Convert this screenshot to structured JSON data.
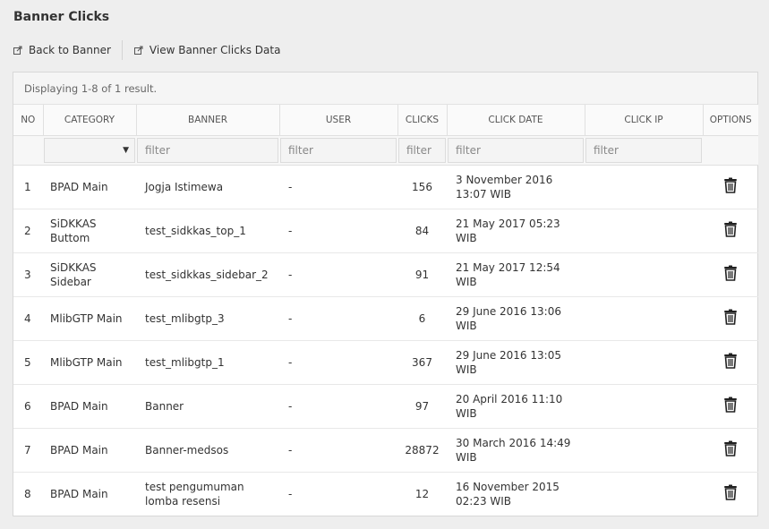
{
  "page": {
    "title": "Banner Clicks"
  },
  "toolbar": {
    "back_label": "Back to Banner",
    "view_data_label": "View Banner Clicks Data"
  },
  "grid": {
    "summary": "Displaying 1-8 of 1 result.",
    "columns": [
      "NO",
      "CATEGORY",
      "BANNER",
      "USER",
      "CLICKS",
      "CLICK DATE",
      "CLICK IP",
      "OPTIONS"
    ],
    "filter_placeholder": "filter",
    "rows": [
      {
        "no": "1",
        "category": "BPAD Main",
        "banner": "Jogja Istimewa",
        "user": "-",
        "clicks": "156",
        "date": "3 November 2016 13:07 WIB",
        "ip": ""
      },
      {
        "no": "2",
        "category": "SiDKKAS Buttom",
        "banner": "test_sidkkas_top_1",
        "user": "-",
        "clicks": "84",
        "date": "21 May 2017 05:23 WIB",
        "ip": ""
      },
      {
        "no": "3",
        "category": "SiDKKAS Sidebar",
        "banner": "test_sidkkas_sidebar_2",
        "user": "-",
        "clicks": "91",
        "date": "21 May 2017 12:54 WIB",
        "ip": ""
      },
      {
        "no": "4",
        "category": "MlibGTP Main",
        "banner": "test_mlibgtp_3",
        "user": "-",
        "clicks": "6",
        "date": "29 June 2016 13:06 WIB",
        "ip": ""
      },
      {
        "no": "5",
        "category": "MlibGTP Main",
        "banner": "test_mlibgtp_1",
        "user": "-",
        "clicks": "367",
        "date": "29 June 2016 13:05 WIB",
        "ip": ""
      },
      {
        "no": "6",
        "category": "BPAD Main",
        "banner": "Banner",
        "user": "-",
        "clicks": "97",
        "date": "20 April 2016 11:10 WIB",
        "ip": ""
      },
      {
        "no": "7",
        "category": "BPAD Main",
        "banner": "Banner-medsos",
        "user": "-",
        "clicks": "28872",
        "date": "30 March 2016 14:49 WIB",
        "ip": ""
      },
      {
        "no": "8",
        "category": "BPAD Main",
        "banner": "test pengumuman lomba resensi",
        "user": "-",
        "clicks": "12",
        "date": "16 November 2015 02:23 WIB",
        "ip": ""
      }
    ]
  }
}
